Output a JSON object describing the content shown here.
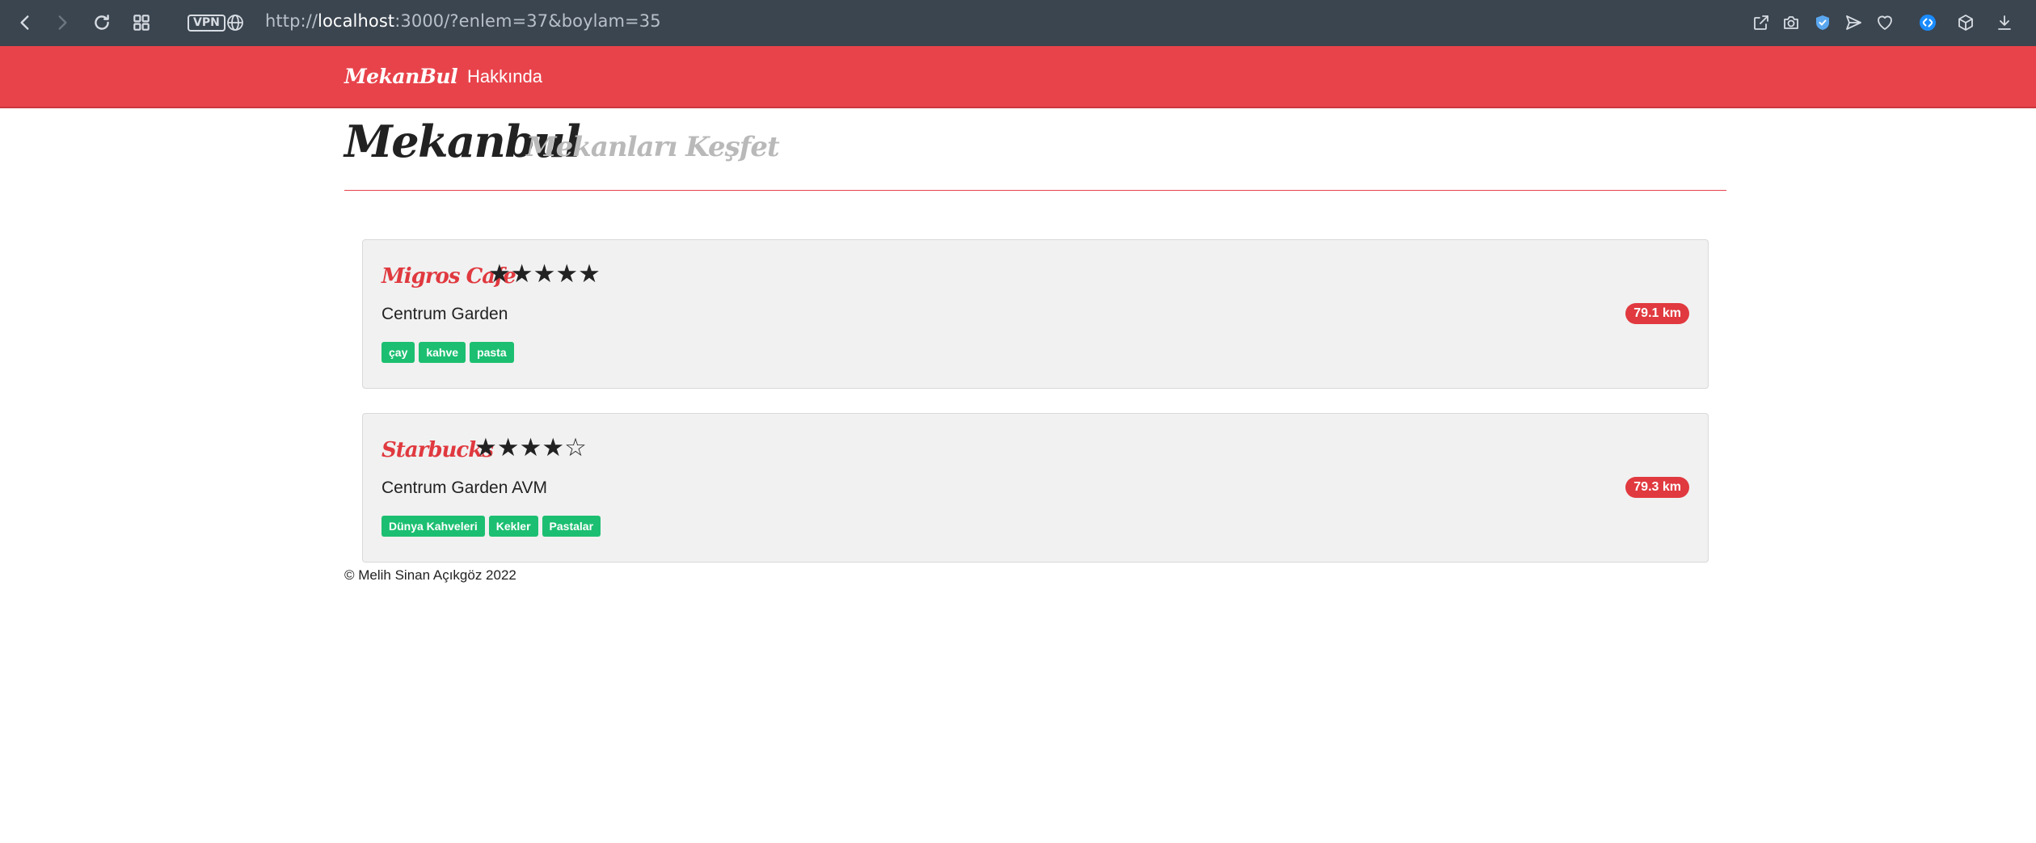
{
  "browser": {
    "url_prefix": "http://",
    "url_host": "localhost",
    "url_rest": ":3000/?enlem=37&boylam=35",
    "vpn_label": "VPN"
  },
  "nav": {
    "brand": "MekanBul",
    "about": "Hakkında"
  },
  "header": {
    "title": "Mekanbul",
    "subtitle": "Mekanları Keşfet"
  },
  "places": [
    {
      "name": "Migros Cafe",
      "rating": 5,
      "stars": "★★★★★",
      "address": "Centrum Garden",
      "distance": "79.1 km",
      "tags": [
        "çay",
        "kahve",
        "pasta"
      ]
    },
    {
      "name": "Starbucks",
      "rating": 4,
      "stars": "★★★★☆",
      "address": "Centrum Garden AVM",
      "distance": "79.3 km",
      "tags": [
        "Dünya Kahveleri",
        "Kekler",
        "Pastalar"
      ]
    }
  ],
  "footer": {
    "text": "© Melih Sinan Açıkgöz 2022"
  },
  "colors": {
    "navbar": "#e8434b",
    "accent": "#e0393f",
    "tag": "#1cbf71",
    "browser_bar": "#3b4550"
  }
}
